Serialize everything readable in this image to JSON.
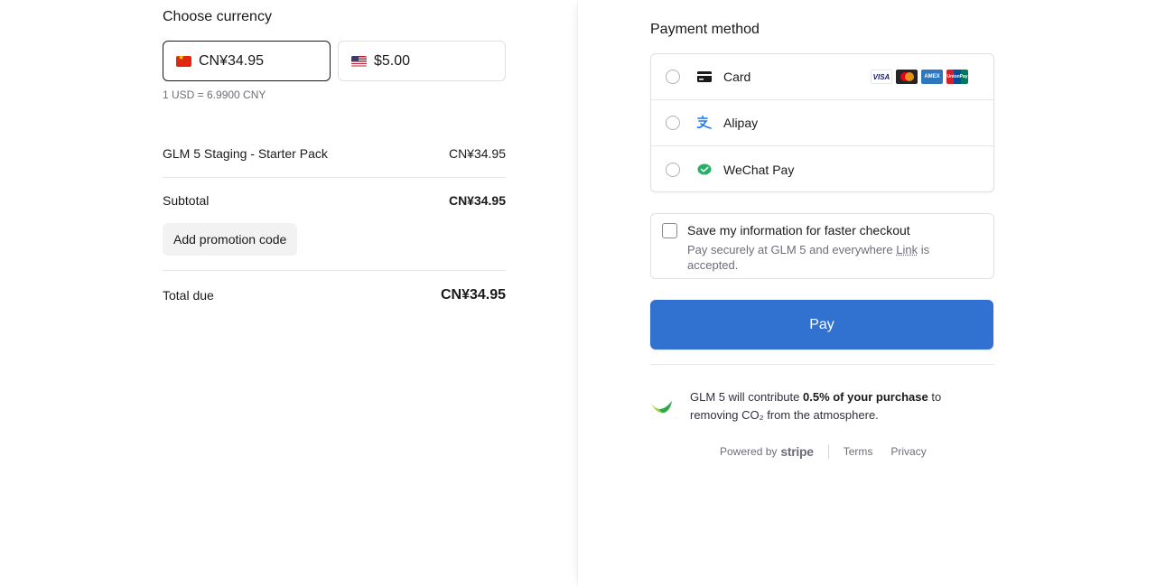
{
  "currency": {
    "title": "Choose currency",
    "options": [
      {
        "label": "CN¥34.95",
        "flag": "cn-flag-icon"
      },
      {
        "label": "$5.00",
        "flag": "us-flag-icon"
      }
    ],
    "rate_note": "1 USD = 6.9900 CNY"
  },
  "summary": {
    "product_name": "GLM 5 Staging - Starter Pack",
    "product_price": "CN¥34.95",
    "subtotal_label": "Subtotal",
    "subtotal_amount": "CN¥34.95",
    "promo_label": "Add promotion code",
    "total_label": "Total due",
    "total_amount": "CN¥34.95"
  },
  "payment": {
    "title": "Payment method",
    "methods": [
      {
        "label": "Card",
        "icon": "card-icon"
      },
      {
        "label": "Alipay",
        "icon": "alipay-icon"
      },
      {
        "label": "WeChat Pay",
        "icon": "wechat-pay-icon"
      }
    ],
    "card_brands": {
      "visa": "VISA",
      "amex": "AMEX",
      "unionpay": "UnionPay"
    }
  },
  "save_info": {
    "title": "Save my information for faster checkout",
    "sub_before": "Pay securely at GLM 5 and everywhere ",
    "sub_link": "Link",
    "sub_after": " is accepted."
  },
  "pay_button": "Pay",
  "climate": {
    "before": "GLM 5 will contribute ",
    "bold": "0.5% of your purchase",
    "after": " to removing CO₂ from the atmosphere."
  },
  "footer": {
    "powered_by": "Powered by",
    "stripe": "stripe",
    "terms": "Terms",
    "privacy": "Privacy"
  },
  "colors": {
    "accent": "#3172d0",
    "alipay": "#1677ff",
    "wechat": "#2aae67"
  }
}
